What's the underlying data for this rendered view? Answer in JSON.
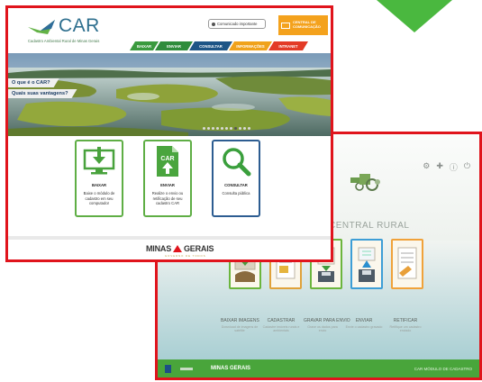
{
  "website": {
    "logo": {
      "brand": "CAR",
      "subtitle": "Cadastro Ambiental Rural de Minas Gerais"
    },
    "communicate_button": "Comunicado importante",
    "central": {
      "line1": "CENTRAL DE",
      "line2": "COMUNICAÇÃO"
    },
    "nav": [
      {
        "label": "BAIXAR",
        "color": "#3a9a3e"
      },
      {
        "label": "ENVIAR",
        "color": "#2f8c3c"
      },
      {
        "label": "CONSULTAR",
        "color": "#1e5586"
      },
      {
        "label": "INFORMAÇÕES",
        "color": "#f0a21b"
      },
      {
        "label": "INTRANET",
        "color": "#e33b26"
      }
    ],
    "banner_links": [
      "O que é o CAR?",
      "Quais suas vantagens?"
    ],
    "carousel": {
      "total": 11,
      "active": 8
    },
    "cards": [
      {
        "title": "BAIXAR",
        "description": "Baixe o módulo de cadastro em seu computador",
        "icon": "download-monitor-icon",
        "border": "#5fae45"
      },
      {
        "title": "ENVIAR",
        "description": "Realize o envio ou retificação de seu cadastro CAR",
        "icon": "upload-document-icon",
        "border": "#5fae45"
      },
      {
        "title": "CONSULTAR",
        "description": "Consulta pública",
        "icon": "magnifier-icon",
        "border": "#2d5d91"
      }
    ],
    "footer_logo": {
      "part1": "MINAS",
      "part2": "GERAIS",
      "tagline": "GOVERNO DE TODOS"
    }
  },
  "desktop_app": {
    "title": "CENTRAL RURAL",
    "actions": [
      {
        "title": "BAIXAR IMAGENS",
        "sub": "Download de imagens de satélite",
        "border": "#6bb53d"
      },
      {
        "title": "CADASTRAR",
        "sub": "Cadastre imóveis rurais e ambientais",
        "border": "#e0a23a"
      },
      {
        "title": "GRAVAR PARA ENVIO",
        "sub": "Grave os dados para envio",
        "border": "#6bb53d"
      },
      {
        "title": "ENVIAR",
        "sub": "Envie o cadastro gravado",
        "border": "#3d9ed6"
      },
      {
        "title": "RETIFICAR",
        "sub": "Retifique um cadastro enviado",
        "border": "#f0a23a"
      }
    ],
    "footer": {
      "logo": "MINAS GERAIS",
      "right_text": "CAR MÓDULO DE CADASTRO"
    },
    "top_icons": [
      "settings-icon",
      "plus-icon",
      "info-icon",
      "power-icon"
    ]
  }
}
